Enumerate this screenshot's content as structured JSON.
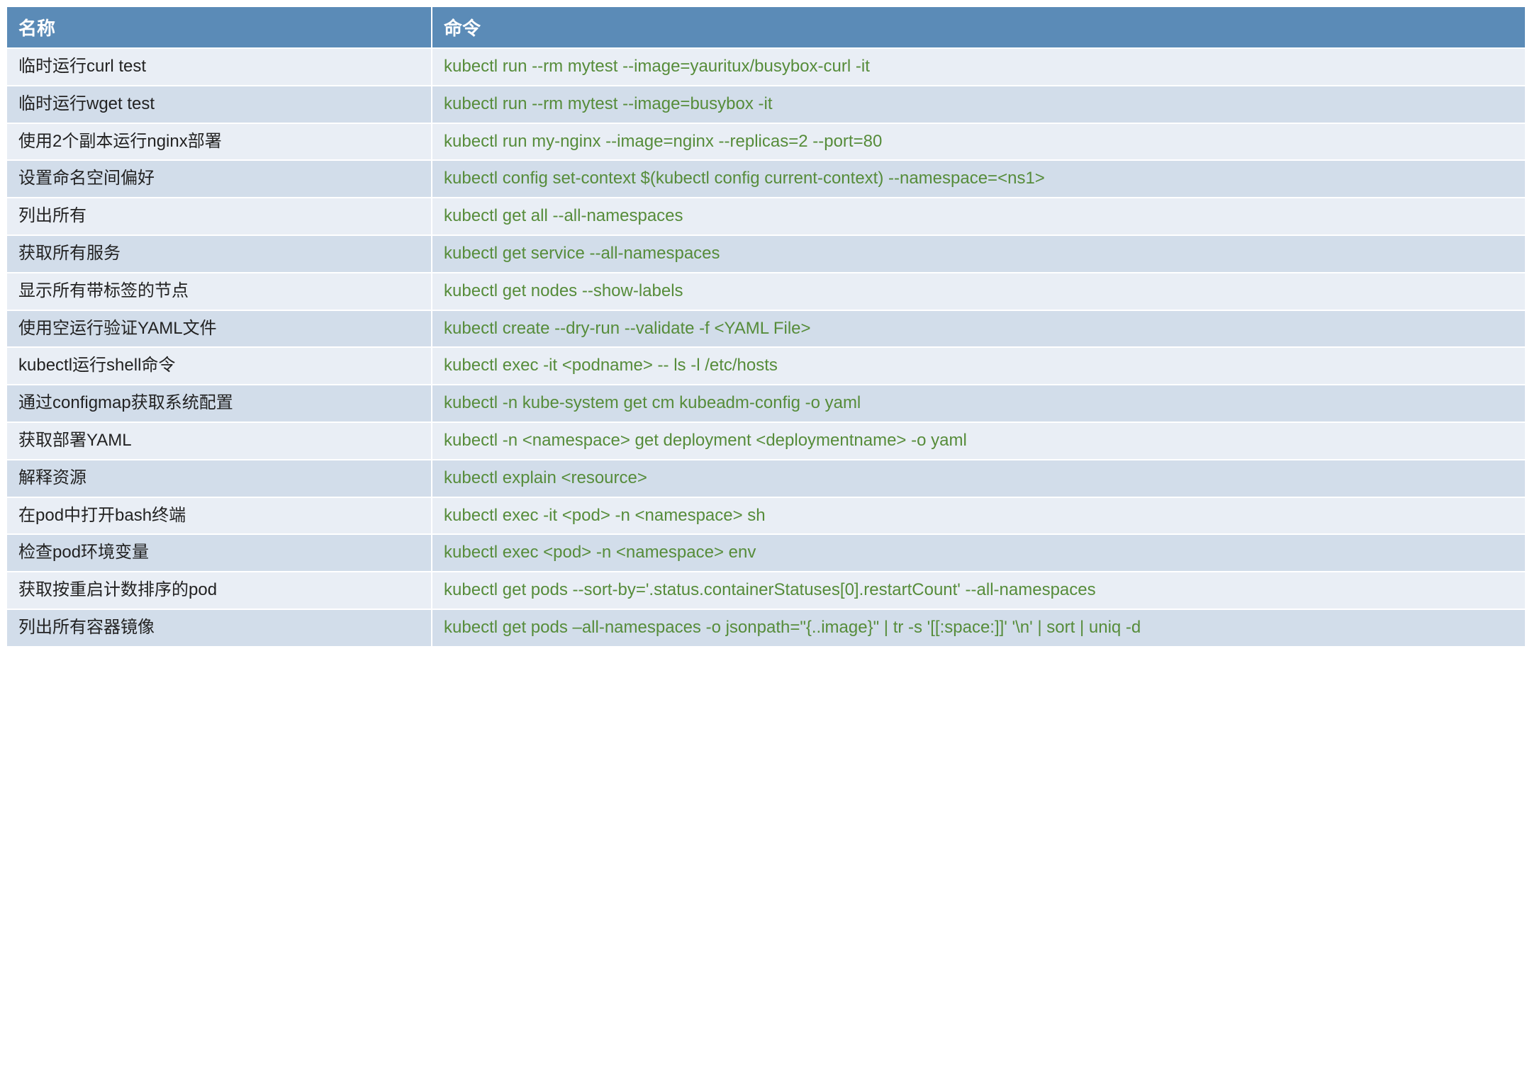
{
  "table": {
    "headers": {
      "name": "名称",
      "command": "命令"
    },
    "rows": [
      {
        "name": "临时运行curl test",
        "command": "kubectl run --rm mytest --image=yauritux/busybox-curl -it"
      },
      {
        "name": "临时运行wget test",
        "command": "kubectl run --rm mytest --image=busybox -it"
      },
      {
        "name": "使用2个副本运行nginx部署",
        "command": "kubectl run my-nginx --image=nginx --replicas=2 --port=80"
      },
      {
        "name": "设置命名空间偏好",
        "command": "kubectl config set-context $(kubectl config current-context) --namespace=<ns1>"
      },
      {
        "name": "列出所有",
        "command": " kubectl get all --all-namespaces"
      },
      {
        "name": "获取所有服务",
        "command": " kubectl get service --all-namespaces"
      },
      {
        "name": "显示所有带标签的节点",
        "command": "kubectl get nodes --show-labels"
      },
      {
        "name": "使用空运行验证YAML文件",
        "command": "kubectl create --dry-run --validate -f <YAML File>"
      },
      {
        "name": "kubectl运行shell命令",
        "command": "kubectl exec -it <podname> -- ls -l /etc/hosts"
      },
      {
        "name": "通过configmap获取系统配置",
        "command": "kubectl -n kube-system get cm kubeadm-config -o yaml"
      },
      {
        "name": "获取部署YAML",
        "command": "kubectl -n <namespace> get deployment <deploymentname> -o yaml"
      },
      {
        "name": "解释资源",
        "command": "kubectl explain <resource>"
      },
      {
        "name": "在pod中打开bash终端",
        "command": "kubectl exec -it <pod> -n <namespace> sh"
      },
      {
        "name": "检查pod环境变量",
        "command": "kubectl exec <pod> -n <namespace> env"
      },
      {
        "name": "获取按重启计数排序的pod",
        "command": "kubectl get pods --sort-by='.status.containerStatuses[0].restartCount' --all-namespaces"
      },
      {
        "name": "列出所有容器镜像",
        "command": "kubectl get pods –all-namespaces -o jsonpath=\"{..image}\" | tr -s '[[:space:]]' '\\n' | sort | uniq -d"
      }
    ]
  }
}
